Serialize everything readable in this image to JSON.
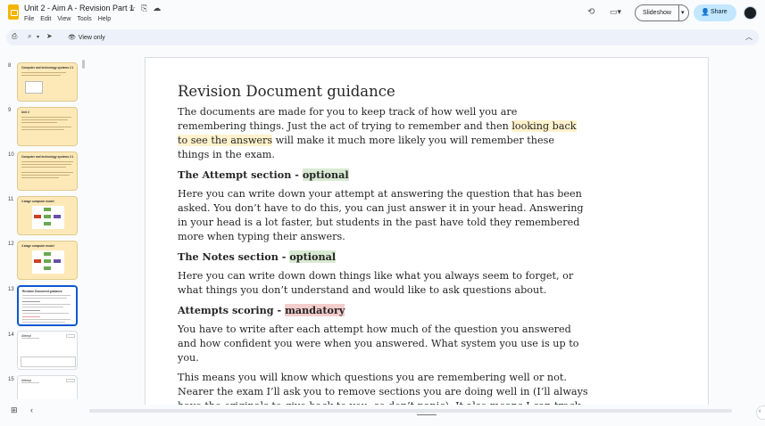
{
  "app": {
    "title": "Unit 2 - Aim A - Revision Part 1",
    "menu": [
      "File",
      "Edit",
      "View",
      "Tools",
      "Help"
    ],
    "icons": {
      "star": "☆",
      "move": "⎘",
      "cloud": "☁"
    }
  },
  "header": {
    "history_icon": "⟲",
    "camera_icon": "▭▾",
    "slideshow_label": "Slideshow",
    "share_label": "Share",
    "share_icon": "👤"
  },
  "toolbar": {
    "print_icon": "⎙",
    "zoom_icon": "⌕",
    "select_icon": "➤",
    "view_only_label": "View only",
    "eye_icon": "👁",
    "collapse_icon": "︿"
  },
  "filmstrip": {
    "slides": [
      {
        "num": "8",
        "title": "Computer and technology systems 2.1",
        "style": "yellow"
      },
      {
        "num": "9",
        "title": "Unit 2",
        "style": "yellow"
      },
      {
        "num": "10",
        "title": "Computer and technology systems 2.1",
        "style": "yellow"
      },
      {
        "num": "11",
        "title": "4 stage computer model",
        "style": "yellow"
      },
      {
        "num": "12",
        "title": "4 stage computer model",
        "style": "yellow"
      },
      {
        "num": "13",
        "title": "Revision Document guidance",
        "style": "selected"
      },
      {
        "num": "14",
        "title": "Attempt",
        "style": "white"
      },
      {
        "num": "15",
        "title": "Attempt",
        "style": "white"
      }
    ]
  },
  "slide": {
    "title": "Revision Document guidance",
    "p1_a": "The documents are made for you to keep track of how well you are remembering things. Just the act of trying to remember and then ",
    "p1_hl": "looking back to see the answers",
    "p1_b": " will make it much more likely you will remember these things in the exam.",
    "h_attempt": "The Attempt section - ",
    "h_attempt_tag": "optional",
    "p2": "Here you can write down your attempt at answering the question that has been asked. You don’t have to do this, you can just answer it in your head. Answering in your head is a lot faster, but students in the past have told they remembered more when typing their answers.",
    "h_notes": "The Notes section - ",
    "h_notes_tag": "optional",
    "p3": "Here you can write down down things like what you always seem to forget, or what things you don’t understand and would like to ask questions about.",
    "h_scoring": "Attempts scoring - ",
    "h_scoring_tag": "mandatory",
    "p4": "You have to write after each attempt how much of the question you answered and how confident you were when you answered. What system you use is up to you.",
    "p5": "This means you will know which questions you are remembering well or not. Nearer the exam I’ll ask you to remove sections you are doing well in (I’ll always have the originals to give back to you, so don’t panic). It also means I can track how much revision you are doing."
  },
  "bottom": {
    "grid_icon": "⊞",
    "prev_icon": "‹",
    "sidebar_icon": "‹"
  }
}
